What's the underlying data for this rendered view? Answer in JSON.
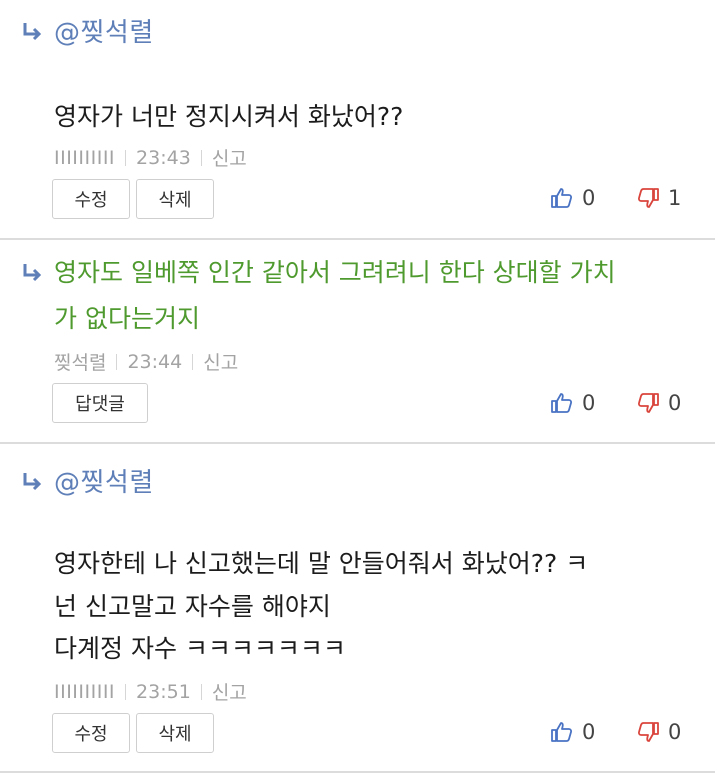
{
  "comments": [
    {
      "mention": "@찢석렬",
      "body": "영자가 너만 정지시켜서 화났어??",
      "author": "IIIIIIIIII",
      "time": "23:43",
      "report": "신고",
      "buttons": [
        "수정",
        "삭제"
      ],
      "likes": "0",
      "dislikes": "1"
    },
    {
      "body_lines": [
        "영자도 일베쪽 인간 같아서 그려려니 한다 상대할 가치",
        "가 없다는거지"
      ],
      "author": "찢석렬",
      "time": "23:44",
      "report": "신고",
      "buttons": [
        "답댓글"
      ],
      "likes": "0",
      "dislikes": "0"
    },
    {
      "mention": "@찢석렬",
      "body_lines": [
        "영자한테 나 신고했는데 말 안들어줘서 화났어?? ㅋ",
        "넌 신고말고 자수를 해야지",
        "다계정 자수 ㅋㅋㅋㅋㅋㅋㅋ"
      ],
      "author": "IIIIIIIIII",
      "time": "23:51",
      "report": "신고",
      "buttons": [
        "수정",
        "삭제"
      ],
      "likes": "0",
      "dislikes": "0"
    }
  ],
  "colors": {
    "mention": "#5e7fb8",
    "reply_green": "#4f9a2e",
    "like_icon": "#4a73c4",
    "dislike_icon": "#d9453c"
  },
  "icons": {
    "reply": "reply-arrow-icon",
    "like": "thumbs-up-icon",
    "dislike": "thumbs-down-icon"
  }
}
